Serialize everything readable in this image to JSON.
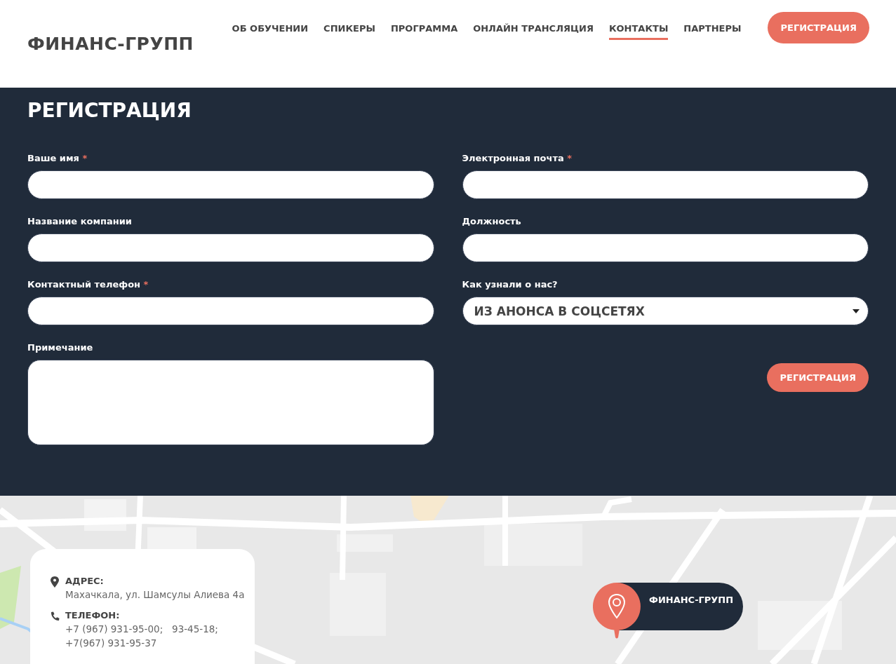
{
  "header": {
    "logo": "ФИНАНС-ГРУПП",
    "nav": [
      {
        "label": "ОБ ОБУЧЕНИИ",
        "selected": false
      },
      {
        "label": "СПИКЕРЫ",
        "selected": false
      },
      {
        "label": "ПРОГРАММА",
        "selected": false
      },
      {
        "label": "ОНЛАЙН ТРАНСЛЯЦИЯ",
        "selected": false
      },
      {
        "label": "КОНТАКТЫ",
        "selected": true
      },
      {
        "label": "ПАРТНЕРЫ",
        "selected": false
      }
    ],
    "button": "РЕГИСТРАЦИЯ"
  },
  "form": {
    "title": "РЕГИСТРАЦИЯ",
    "fields": [
      {
        "label": "Ваше имя",
        "required_mark": "*",
        "kind": "input"
      },
      {
        "label": "Электронная почта",
        "required_mark": "*",
        "kind": "input"
      },
      {
        "label": "Название компании",
        "kind": "input"
      },
      {
        "label": "Должность",
        "kind": "input"
      },
      {
        "label": "Контактный телефон",
        "required_mark": "*",
        "kind": "input"
      },
      {
        "label": "Как узнали о нас?",
        "kind": "select",
        "value": "ИЗ АНОНСА В СОЦСЕТЯХ"
      },
      {
        "label": "Примечание",
        "kind": "textarea"
      }
    ],
    "submit": "РЕГИСТРАЦИЯ"
  },
  "map": {
    "kind": "picture",
    "contact_card": {
      "address_label": "АДРЕС:",
      "address": "Махачкала, ул. Шамсулы Алиева 4а",
      "phone_label": "ТЕЛЕФОН:",
      "phone_lines": [
        "+7 (967) 931-95-00;   93-45-18;",
        "+7(967) 931-95-37"
      ]
    },
    "marker": {
      "label": "ФИНАНС-ГРУПП"
    }
  }
}
